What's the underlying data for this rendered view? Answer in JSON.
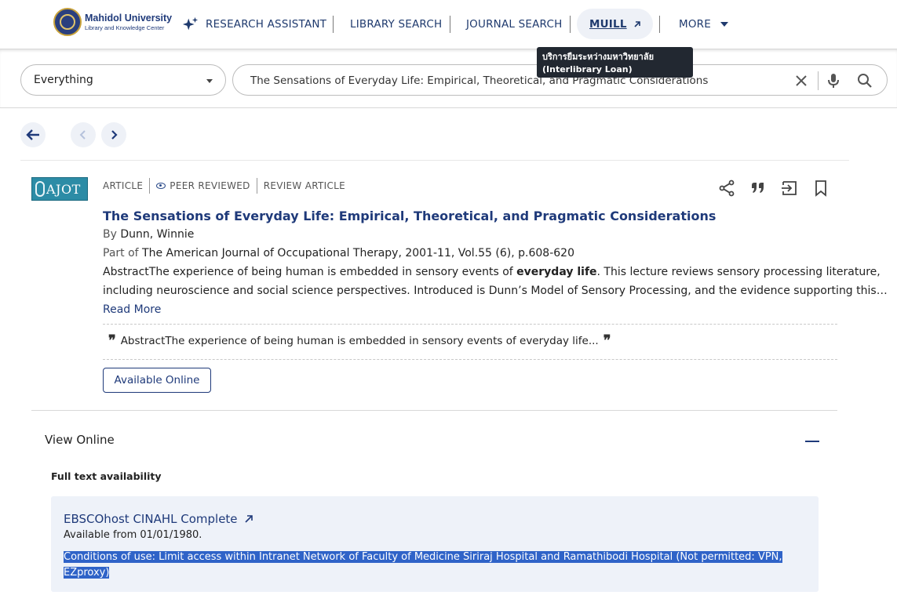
{
  "nav": {
    "logo_line1": "Mahidol University",
    "logo_line2": "Library and Knowledge Center",
    "research_assistant": "RESEARCH ASSISTANT",
    "library_search": "LIBRARY SEARCH",
    "journal_search": "JOURNAL SEARCH",
    "muill": "MUILL",
    "more": "MORE",
    "tooltip_line1": "บริการยืมระหว่างมหาวิทยาลัย",
    "tooltip_line2": "(Interlibrary Loan)"
  },
  "search": {
    "scope": "Everything",
    "query": "The Sensations of Everyday Life: Empirical, Theoretical, and Pragmatic Considerations"
  },
  "record": {
    "thumb_text": "AJOT",
    "tags": [
      "ARTICLE",
      "PEER REVIEWED",
      "REVIEW ARTICLE"
    ],
    "title": "The Sensations of Everyday Life: Empirical, Theoretical, and Pragmatic Considerations",
    "by_label": "By",
    "author": "Dunn, Winnie",
    "part_of_label": "Part of",
    "source": "The American Journal of Occupational Therapy, 2001-11, Vol.55 (6), p.608-620",
    "abstract_1a": "AbstractThe experience of being human is embedded in sensory events of ",
    "abstract_1b": "everyday life",
    "abstract_1c": ". This lecture reviews sensory processing literature,",
    "abstract_2": "including neuroscience and social science perspectives. Introduced is Dunn’s Model of Sensory Processing, and the evidence supporting this…",
    "read_more": "Read More",
    "snippet": "AbstractThe experience of being human is embedded in sensory events of everyday life...",
    "available_online": "Available Online"
  },
  "view_online": {
    "title": "View Online",
    "full_text_label": "Full text availability",
    "provider": "EBSCOhost CINAHL Complete",
    "available_from": "Available from 01/01/1980.",
    "conditions_1": "Conditions of use: Limit access within Intranet Network of Faculty of Medicine Siriraj Hospital and Ramathibodi Hospital (Not permitted: VPN,",
    "conditions_2": "EZproxy)"
  },
  "colors": {
    "brand": "#1f3a7a",
    "selection": "#2f63c8",
    "card_bg": "#eef2f9"
  }
}
